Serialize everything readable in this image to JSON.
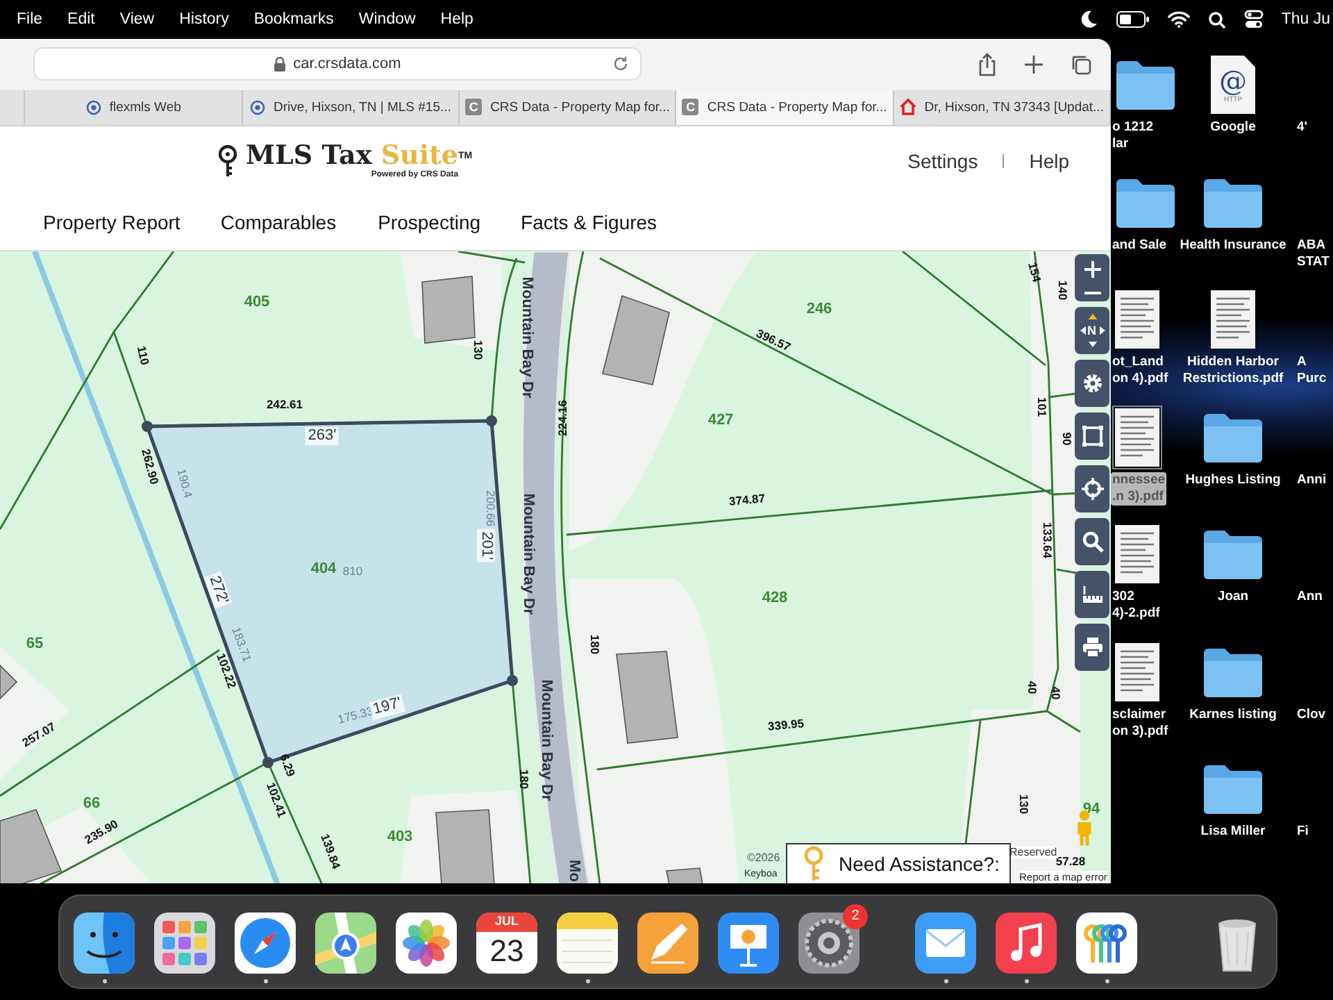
{
  "menu_bar": {
    "items": [
      "File",
      "Edit",
      "View",
      "History",
      "Bookmarks",
      "Window",
      "Help"
    ],
    "clock": "Thu Ju"
  },
  "browser": {
    "address": "car.crsdata.com",
    "tabs": [
      {
        "title": "flexmls Web",
        "kind": "globe",
        "selected": false
      },
      {
        "title": "Drive, Hixson, TN | MLS #15...",
        "kind": "globe",
        "selected": false
      },
      {
        "title": "CRS Data - Property Map for...",
        "kind": "crs",
        "letter": "C",
        "selected": false
      },
      {
        "title": "CRS Data - Property Map for...",
        "kind": "crs",
        "letter": "C",
        "selected": true
      },
      {
        "title": "Dr, Hixson, TN 37343 [Updat...",
        "kind": "house",
        "selected": false
      }
    ]
  },
  "site": {
    "logo": "MLS Tax",
    "logo_accent": "Suite",
    "trademark": "TM",
    "tagline": "Powered by CRS Data",
    "links": [
      "Settings",
      "Help"
    ],
    "nav": [
      "Property Report",
      "Comparables",
      "Prospecting",
      "Facts & Figures"
    ]
  },
  "map": {
    "labels": [
      {
        "text": "405",
        "kind": "lot"
      },
      {
        "text": "404",
        "kind": "lot"
      },
      {
        "text": "810",
        "kind": "faint"
      },
      {
        "text": "65",
        "kind": "lot"
      },
      {
        "text": "66",
        "kind": "lot"
      },
      {
        "text": "403",
        "kind": "lot"
      },
      {
        "text": "246",
        "kind": "lot"
      },
      {
        "text": "427",
        "kind": "lot"
      },
      {
        "text": "428",
        "kind": "lot"
      },
      {
        "text": "94",
        "kind": "lot"
      },
      {
        "text": "110",
        "kind": "dim"
      },
      {
        "text": "242.61",
        "kind": "dim"
      },
      {
        "text": "263'",
        "kind": "boxed"
      },
      {
        "text": "262.90",
        "kind": "dim"
      },
      {
        "text": "190.4",
        "kind": "faint"
      },
      {
        "text": "200.66",
        "kind": "faint"
      },
      {
        "text": "201'",
        "kind": "boxed"
      },
      {
        "text": "272'",
        "kind": "boxed"
      },
      {
        "text": "183.71",
        "kind": "faint"
      },
      {
        "text": "102.22",
        "kind": "dim"
      },
      {
        "text": "175.33",
        "kind": "faint"
      },
      {
        "text": "197'",
        "kind": "boxed"
      },
      {
        "text": "6.29",
        "kind": "dim"
      },
      {
        "text": "102.41",
        "kind": "dim"
      },
      {
        "text": "139.84",
        "kind": "dim"
      },
      {
        "text": "257.07",
        "kind": "dim"
      },
      {
        "text": "235.90",
        "kind": "dim"
      },
      {
        "text": "130",
        "kind": "dim"
      },
      {
        "text": "180",
        "kind": "dim"
      },
      {
        "text": "224.16",
        "kind": "dim"
      },
      {
        "text": "396.57",
        "kind": "dim"
      },
      {
        "text": "374.87",
        "kind": "dim"
      },
      {
        "text": "339.95",
        "kind": "dim"
      },
      {
        "text": "154",
        "kind": "dim"
      },
      {
        "text": "140",
        "kind": "dim"
      },
      {
        "text": "101",
        "kind": "dim"
      },
      {
        "text": "90",
        "kind": "dim"
      },
      {
        "text": "133.64",
        "kind": "dim"
      },
      {
        "text": "180",
        "kind": "dim"
      },
      {
        "text": "40",
        "kind": "dim"
      },
      {
        "text": "40",
        "kind": "dim"
      },
      {
        "text": "130",
        "kind": "dim"
      },
      {
        "text": "57.28",
        "kind": "dim"
      },
      {
        "text": "Mountain Bay Dr",
        "kind": "street"
      },
      {
        "text": "Mountain Bay Dr",
        "kind": "street"
      },
      {
        "text": "Mountain Bay Dr",
        "kind": "street"
      },
      {
        "text": "Mo",
        "kind": "street"
      }
    ],
    "compass": "N",
    "copyright": "©2026",
    "keyboard": "Keyboa",
    "reserved": "Reserved",
    "report": "Report a map error",
    "assistance": "Need Assistance?:"
  },
  "desktop": {
    "columns": [
      {
        "icons": [
          {
            "lines": [
              "o 1212",
              "lar"
            ],
            "kind": "folder",
            "selected": false
          },
          {
            "lines": [
              "and  Sale"
            ],
            "kind": "folder",
            "selected": false
          },
          {
            "lines": [
              "ot_Land",
              "on 4).pdf"
            ],
            "kind": "document",
            "selected": false
          },
          {
            "lines": [
              "nnessee",
              ".n 3).pdf"
            ],
            "kind": "document",
            "selected": true
          },
          {
            "lines": [
              "302",
              "4)-2.pdf"
            ],
            "kind": "document",
            "selected": false
          },
          {
            "lines": [
              "sclaimer",
              "on 3).pdf"
            ],
            "kind": "document",
            "selected": false
          }
        ]
      },
      {
        "icons": [
          {
            "lines": [
              "Google"
            ],
            "kind": "web",
            "symbol": "@",
            "caption": "HTTP",
            "selected": false
          },
          {
            "lines": [
              "Health Insurance"
            ],
            "kind": "folder",
            "selected": false
          },
          {
            "lines": [
              "Hidden Harbor",
              "Restrictions.pdf"
            ],
            "kind": "document",
            "selected": false
          },
          {
            "lines": [
              "Hughes Listing"
            ],
            "kind": "folder",
            "selected": false
          },
          {
            "lines": [
              "Joan"
            ],
            "kind": "folder",
            "selected": false
          },
          {
            "lines": [
              "Karnes listing"
            ],
            "kind": "folder",
            "selected": false
          },
          {
            "lines": [
              "Lisa Miller"
            ],
            "kind": "folder",
            "selected": false
          }
        ]
      },
      {
        "icons": [
          {
            "lines": [
              "4'"
            ],
            "kind": "offscreen",
            "selected": false
          },
          {
            "lines": [
              "ABA",
              "STAT"
            ],
            "kind": "offscreen",
            "selected": false
          },
          {
            "lines": [
              "A",
              "Purc"
            ],
            "kind": "offscreen",
            "selected": false
          },
          {
            "lines": [
              "Anni"
            ],
            "kind": "offscreen",
            "selected": false
          },
          {
            "lines": [
              "Ann"
            ],
            "kind": "offscreen",
            "selected": false
          },
          {
            "lines": [
              "Clov"
            ],
            "kind": "offscreen",
            "selected": false
          },
          {
            "lines": [
              "Fi"
            ],
            "kind": "offscreen",
            "selected": false
          }
        ]
      }
    ]
  },
  "dock": {
    "apps": [
      {
        "kind": "finder",
        "running": true
      },
      {
        "kind": "launchpad",
        "running": false
      },
      {
        "kind": "safari",
        "running": true
      },
      {
        "kind": "maps",
        "running": false
      },
      {
        "kind": "photos",
        "running": false
      },
      {
        "kind": "calendar",
        "running": false,
        "month": "JUL",
        "day": "23"
      },
      {
        "kind": "notes",
        "running": true
      },
      {
        "kind": "pen",
        "running": false
      },
      {
        "kind": "keynote",
        "running": false
      },
      {
        "kind": "settings",
        "running": false,
        "badge": "2"
      },
      {
        "kind": "separator"
      },
      {
        "kind": "mail",
        "running": true
      },
      {
        "kind": "music",
        "running": true
      },
      {
        "kind": "passwords",
        "running": true
      },
      {
        "kind": "separator"
      },
      {
        "kind": "trash",
        "running": false
      }
    ]
  }
}
